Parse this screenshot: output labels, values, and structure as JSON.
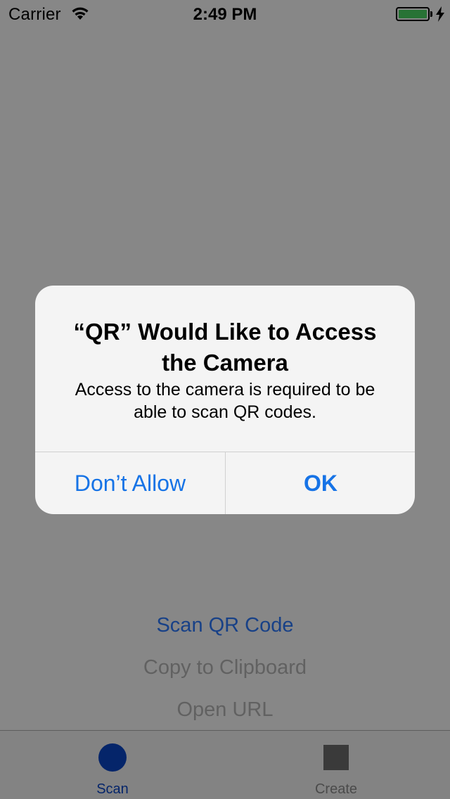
{
  "status_bar": {
    "carrier": "Carrier",
    "time": "2:49 PM",
    "wifi_icon": "wifi-icon",
    "battery_icon": "battery-icon",
    "charging_icon": "charging-bolt-icon",
    "battery_color": "#4cd964"
  },
  "main": {
    "actions": [
      {
        "label": "Scan QR Code",
        "style": "primary"
      },
      {
        "label": "Copy to Clipboard",
        "style": "secondary"
      },
      {
        "label": "Open URL",
        "style": "secondary"
      }
    ]
  },
  "tab_bar": {
    "tabs": [
      {
        "label": "Scan",
        "icon": "circle-icon",
        "selected": true,
        "color": "#0a46c9"
      },
      {
        "label": "Create",
        "icon": "square-icon",
        "selected": false,
        "color": "#8e8e8e"
      }
    ]
  },
  "alert": {
    "title": "“QR” Would Like to Access the Camera",
    "message": "Access to the camera is required to be able to scan QR codes.",
    "buttons": {
      "dont_allow": "Don’t Allow",
      "ok": "OK"
    },
    "button_color": "#1673e6"
  }
}
